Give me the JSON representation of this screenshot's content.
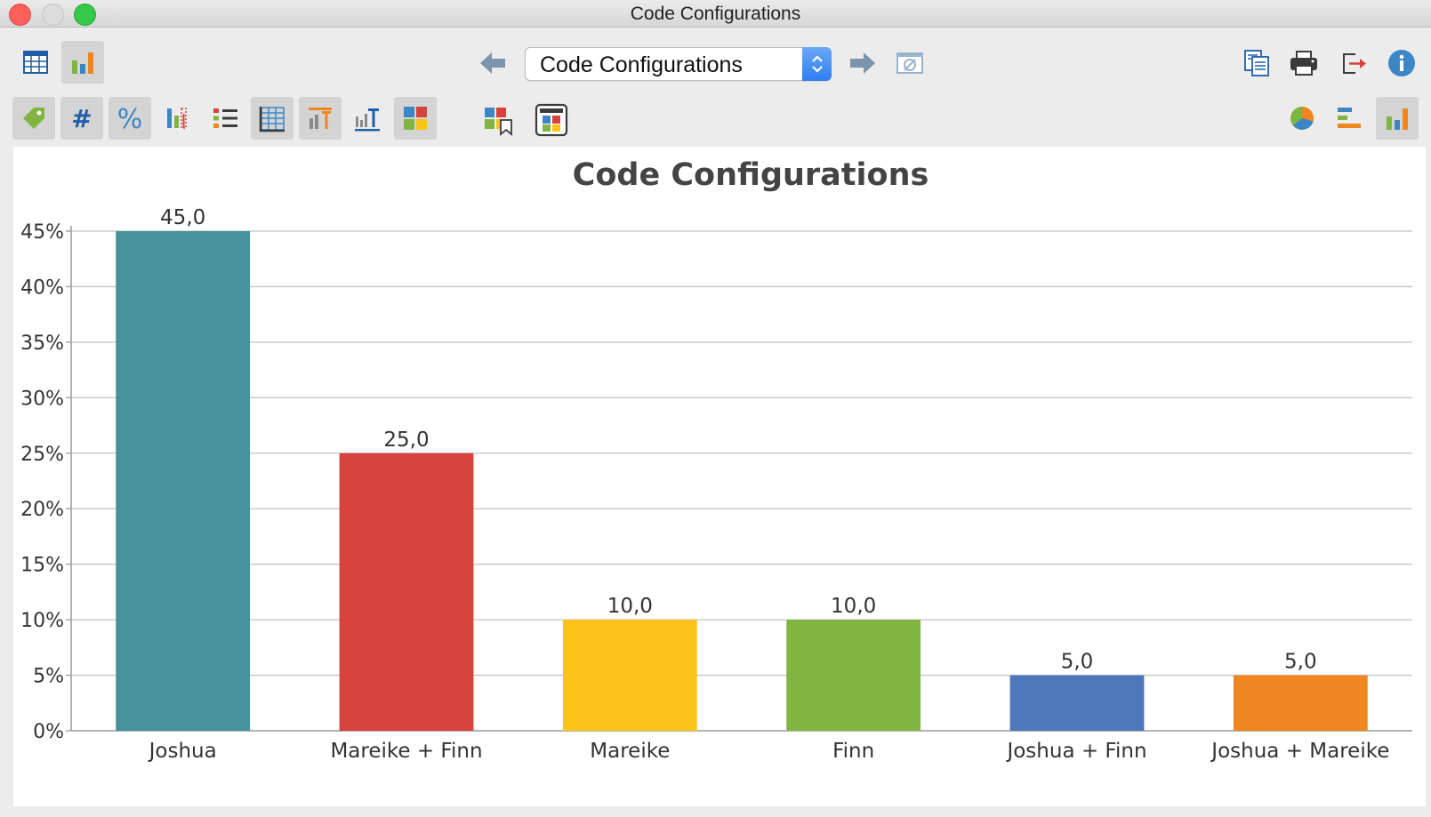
{
  "window": {
    "title": "Code Configurations"
  },
  "toolbar": {
    "selector_value": "Code Configurations",
    "icons": {
      "row1_left": [
        "table-view-icon",
        "chart-view-icon"
      ],
      "nav": [
        "back-arrow-icon",
        "forward-arrow-icon",
        "clear-filter-icon"
      ],
      "row1_right": [
        "copy-icon",
        "print-icon",
        "export-icon",
        "info-icon"
      ],
      "row2_left": [
        "tag-icon",
        "hash-count-icon",
        "percent-icon",
        "column-percent-icon",
        "list-icon",
        "grid-icon",
        "chart-title-icon",
        "axis-title-icon",
        "color-palette-icon"
      ],
      "row2_mid": [
        "bookmark-colors-icon",
        "frame-colors-icon"
      ],
      "row2_right": [
        "pie-chart-icon",
        "horizontal-bar-icon",
        "vertical-bar-icon"
      ]
    }
  },
  "chart_data": {
    "type": "bar",
    "title": "Code Configurations",
    "categories": [
      "Joshua",
      "Mareike + Finn",
      "Mareike",
      "Finn",
      "Joshua + Finn",
      "Joshua + Mareike"
    ],
    "values": [
      45.0,
      25.0,
      10.0,
      10.0,
      5.0,
      5.0
    ],
    "value_labels": [
      "45,0",
      "25,0",
      "10,0",
      "10,0",
      "5,0",
      "5,0"
    ],
    "colors": [
      "#46919b",
      "#d5433c",
      "#fcc318",
      "#80b541",
      "#4e77bc",
      "#f0861f"
    ],
    "yticks": [
      "0%",
      "5%",
      "10%",
      "15%",
      "20%",
      "25%",
      "30%",
      "35%",
      "40%",
      "45%"
    ],
    "ylim": [
      0,
      45
    ],
    "grid": true,
    "xlabel": "",
    "ylabel": ""
  }
}
